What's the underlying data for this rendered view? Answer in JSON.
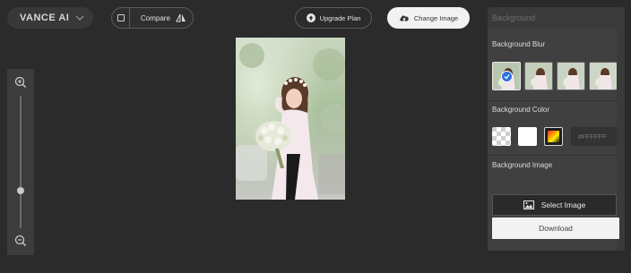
{
  "header": {
    "logo_text": "VANCE AI",
    "compare_label": "Compare",
    "upgrade_label": "Upgrade Plan",
    "change_label": "Change Image"
  },
  "panel": {
    "title": "Background",
    "blur_title": "Background Blur",
    "color_title": "Background Color",
    "hex_value": "#FFFFFF",
    "image_title": "Background Image",
    "select_label": "Select Image",
    "download_label": "Download"
  },
  "colors": {
    "accent": "#2E6FE0",
    "page_bg": "#2B2B2B",
    "panel_bg": "#404040"
  }
}
